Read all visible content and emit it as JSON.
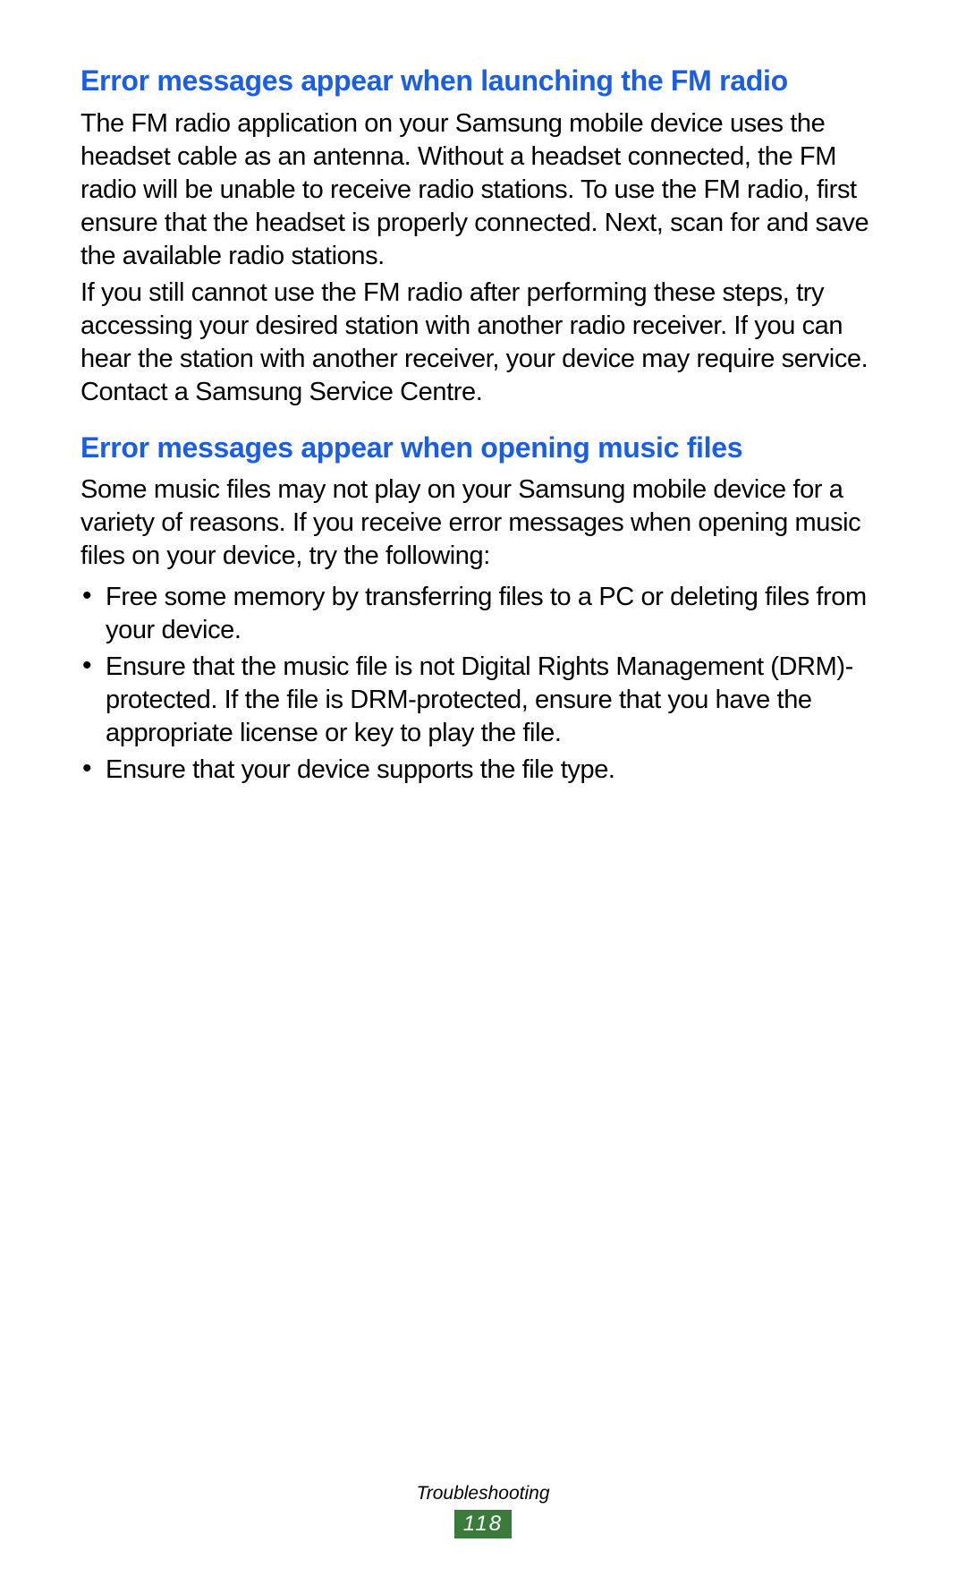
{
  "section1": {
    "heading": "Error messages appear when launching the FM radio",
    "para1": "The FM radio application on your Samsung mobile device uses the headset cable as an antenna. Without a headset connected, the FM radio will be unable to receive radio stations. To use the FM radio, first ensure that the headset is properly connected. Next, scan for and save the available radio stations.",
    "para2": "If you still cannot use the FM radio after performing these steps, try accessing your desired station with another radio receiver. If you can hear the station with another receiver, your device may require service. Contact a Samsung Service Centre."
  },
  "section2": {
    "heading": "Error messages appear when opening music files",
    "intro": "Some music files may not play on your Samsung mobile device for a variety of reasons. If you receive error messages when opening music files on your device, try the following:",
    "bullets": [
      "Free some memory by transferring files to a PC or deleting files from your device.",
      "Ensure that the music file is not Digital Rights Management (DRM)-protected. If the file is DRM-protected, ensure that you have the appropriate license or key to play the file.",
      "Ensure that your device supports the file type."
    ]
  },
  "footer": {
    "section_label": "Troubleshooting",
    "page_number": "118"
  }
}
